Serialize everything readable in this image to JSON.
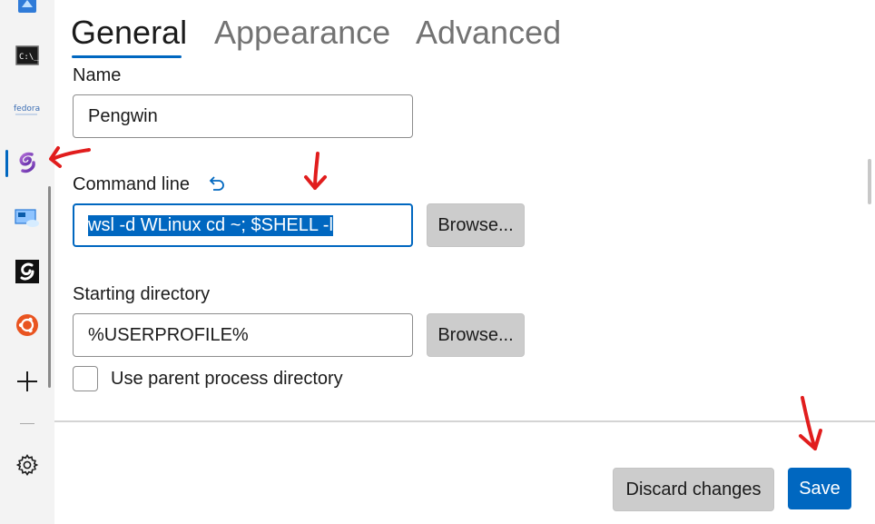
{
  "sidebar": {
    "items": [
      {
        "icon": "azure-cloud-shell-icon"
      },
      {
        "icon": "command-prompt-icon",
        "label": "C:\\_"
      },
      {
        "icon": "fedora-icon",
        "label": "fedora"
      },
      {
        "icon": "pengwin-icon"
      },
      {
        "icon": "remote-desktop-icon"
      },
      {
        "icon": "debian-icon"
      },
      {
        "icon": "ubuntu-icon"
      },
      {
        "icon": "add-profile-icon"
      }
    ],
    "settings_icon": "gear-icon"
  },
  "tabs": [
    {
      "label": "General",
      "selected": true
    },
    {
      "label": "Appearance",
      "selected": false
    },
    {
      "label": "Advanced",
      "selected": false
    }
  ],
  "form": {
    "name_label": "Name",
    "name_value": "Pengwin",
    "command_label": "Command line",
    "command_value": "wsl -d WLinux cd ~; $SHELL -l",
    "browse_label": "Browse...",
    "starting_dir_label": "Starting directory",
    "starting_dir_value": "%USERPROFILE%",
    "use_parent_label": "Use parent process directory",
    "use_parent_checked": false
  },
  "footer": {
    "discard_label": "Discard changes",
    "save_label": "Save"
  },
  "colors": {
    "accent": "#0067c0",
    "annotation": "#e11d1d",
    "sidebar_bg": "#f3f3f3"
  }
}
